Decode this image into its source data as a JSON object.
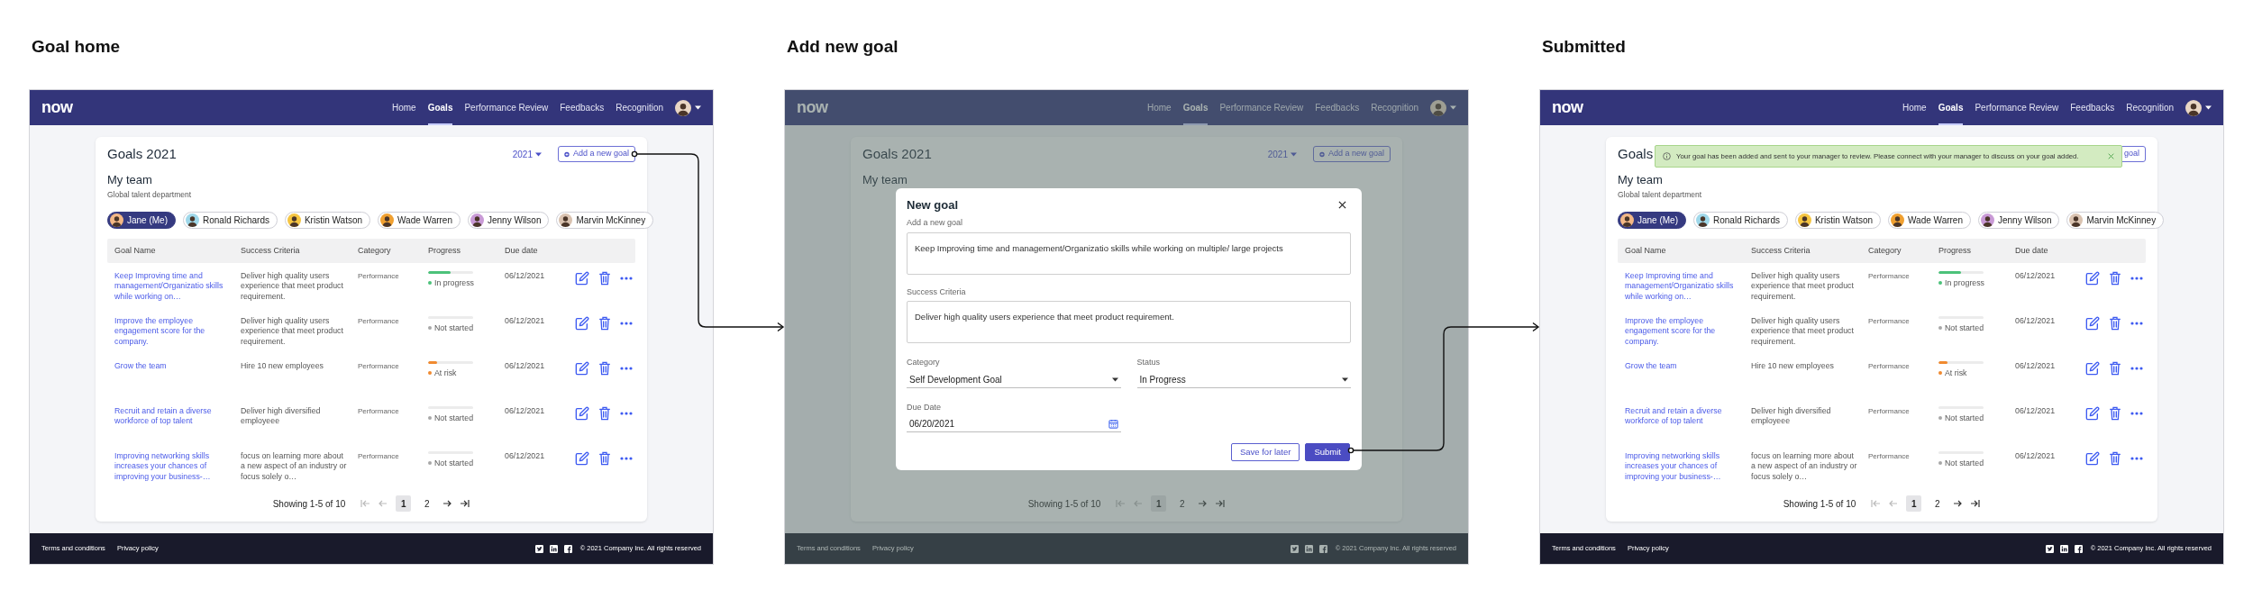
{
  "screens": [
    {
      "kind": "home",
      "title": "Goal home",
      "nav": {
        "logo": "now",
        "items": [
          {
            "label": "Home",
            "selected": false
          },
          {
            "label": "Goals",
            "selected": true
          },
          {
            "label": "Performance Review",
            "selected": false
          },
          {
            "label": "Feedbacks",
            "selected": false
          },
          {
            "label": "Recognition",
            "selected": false
          }
        ]
      },
      "card": {
        "heading": "Goals 2021",
        "year": "2021",
        "add_button": "Add a new goal",
        "team_title": "My team",
        "team_subtitle": "Global talent department",
        "members": [
          {
            "name": "Jane (Me)",
            "selected": true
          },
          {
            "name": "Ronald Richards",
            "selected": false
          },
          {
            "name": "Kristin Watson",
            "selected": false
          },
          {
            "name": "Wade Warren",
            "selected": false
          },
          {
            "name": "Jenny Wilson",
            "selected": false
          },
          {
            "name": "Marvin McKinney",
            "selected": false
          }
        ],
        "table": {
          "columns": [
            "Goal Name",
            "Success Criteria",
            "Category",
            "Progress",
            "Due date"
          ],
          "rows": [
            {
              "goal": "Keep Improving time and management/Organizatio skills while working on…",
              "criteria": "Deliver high quality users experience that meet product requirement.",
              "category": "Performance",
              "level": 0.5,
              "status": "In progress",
              "color": "#4cc27a",
              "due": "06/12/2021"
            },
            {
              "goal": "Improve the employee engagement score for the company.",
              "criteria": "Deliver high quality users experience that meet product requirement.",
              "category": "Performance",
              "level": 0,
              "status": "Not started",
              "color": "#a8a8a8",
              "due": "06/12/2021"
            },
            {
              "goal": "Grow the team",
              "criteria": "Hire 10 new employees",
              "category": "Performance",
              "level": 0.2,
              "status": "At risk",
              "color": "#f08a30",
              "due": "06/12/2021"
            },
            {
              "goal": "Recruit and retain a diverse workforce of top talent",
              "criteria": "Deliver high diversified employeee",
              "category": "Performance",
              "level": 0,
              "status": "Not started",
              "color": "#a8a8a8",
              "due": "06/12/2021"
            },
            {
              "goal": "Improving networking skills increases your chances of improving your business-…",
              "criteria": "focus on learning more about a new aspect of an industry or focus solely o…",
              "category": "Performance",
              "level": 0,
              "status": "Not started",
              "color": "#a8a8a8",
              "due": "06/12/2021"
            }
          ]
        },
        "pagination": {
          "summary": "Showing 1-5 of 10",
          "pages": [
            {
              "label": "1",
              "selected": true
            },
            {
              "label": "2",
              "selected": false
            }
          ]
        }
      },
      "footer": {
        "links": [
          "Terms and conditions",
          "Privacy policy"
        ],
        "copyright": "© 2021 Company Inc. All rights reserved"
      }
    },
    {
      "kind": "modal",
      "title": "Add new goal",
      "nav": {
        "logo": "now",
        "items": [
          {
            "label": "Home",
            "selected": false
          },
          {
            "label": "Goals",
            "selected": true
          },
          {
            "label": "Performance Review",
            "selected": false
          },
          {
            "label": "Feedbacks",
            "selected": false
          },
          {
            "label": "Recognition",
            "selected": false
          }
        ]
      },
      "card": {
        "heading": "Goals 2021",
        "year": "2021",
        "add_button": "Add a new goal",
        "team_title": "My team",
        "pagination": {
          "summary": "Showing 1-5 of 10",
          "pages": [
            {
              "label": "1",
              "selected": true
            },
            {
              "label": "2",
              "selected": false
            }
          ]
        }
      },
      "footer": {
        "links": [
          "Terms and conditions",
          "Privacy policy"
        ],
        "copyright": "© 2021 Company Inc. All rights reserved"
      },
      "modal": {
        "title": "New goal",
        "fields": [
          {
            "kind": "textarea",
            "label": "Add a new goal",
            "value": "Keep Improving time and management/Organizatio skills while working on multiple/ large projects"
          },
          {
            "kind": "textarea",
            "label": "Success Criteria",
            "value": "Deliver high quality users experience that meet product requirement."
          },
          {
            "kind": "select",
            "label": "Category",
            "value": "Self Development Goal"
          },
          {
            "kind": "select",
            "label": "Status",
            "value": "In Progress"
          },
          {
            "kind": "date",
            "label": "Due Date",
            "value": "06/20/2021"
          }
        ],
        "buttons": [
          {
            "kind": "secondary",
            "label": "Save for later"
          },
          {
            "kind": "primary",
            "label": "Submit"
          }
        ]
      }
    },
    {
      "kind": "toast",
      "title": "Submitted",
      "nav": {
        "logo": "now",
        "items": [
          {
            "label": "Home",
            "selected": false
          },
          {
            "label": "Goals",
            "selected": true
          },
          {
            "label": "Performance Review",
            "selected": false
          },
          {
            "label": "Feedbacks",
            "selected": false
          },
          {
            "label": "Recognition",
            "selected": false
          }
        ]
      },
      "card": {
        "heading": "Goals",
        "add_button": "goal",
        "team_title": "My team",
        "team_subtitle": "Global talent department",
        "members": [
          {
            "name": "Jane (Me)",
            "selected": true
          },
          {
            "name": "Ronald Richards",
            "selected": false
          },
          {
            "name": "Kristin Watson",
            "selected": false
          },
          {
            "name": "Wade Warren",
            "selected": false
          },
          {
            "name": "Jenny Wilson",
            "selected": false
          },
          {
            "name": "Marvin McKinney",
            "selected": false
          }
        ],
        "table": {
          "columns": [
            "Goal Name",
            "Success Criteria",
            "Category",
            "Progress",
            "Due date"
          ],
          "rows": [
            {
              "goal": "Keep Improving time and management/Organizatio skills while working on…",
              "criteria": "Deliver high quality users experience that meet product requirement.",
              "category": "Performance",
              "level": 0.5,
              "status": "In progress",
              "color": "#4cc27a",
              "due": "06/12/2021"
            },
            {
              "goal": "Improve the employee engagement score for the company.",
              "criteria": "Deliver high quality users experience that meet product requirement.",
              "category": "Performance",
              "level": 0,
              "status": "Not started",
              "color": "#a8a8a8",
              "due": "06/12/2021"
            },
            {
              "goal": "Grow the team",
              "criteria": "Hire 10 new employees",
              "category": "Performance",
              "level": 0.2,
              "status": "At risk",
              "color": "#f08a30",
              "due": "06/12/2021"
            },
            {
              "goal": "Recruit and retain a diverse workforce of top talent",
              "criteria": "Deliver high diversified employeee",
              "category": "Performance",
              "level": 0,
              "status": "Not started",
              "color": "#a8a8a8",
              "due": "06/12/2021"
            },
            {
              "goal": "Improving networking skills increases your chances of improving your business-…",
              "criteria": "focus on learning more about a new aspect of an industry or focus solely o…",
              "category": "Performance",
              "level": 0,
              "status": "Not started",
              "color": "#a8a8a8",
              "due": "06/12/2021"
            }
          ]
        },
        "pagination": {
          "summary": "Showing 1-5 of 10",
          "pages": [
            {
              "label": "1",
              "selected": true
            },
            {
              "label": "2",
              "selected": false
            }
          ]
        }
      },
      "footer": {
        "links": [
          "Terms and conditions",
          "Privacy policy"
        ],
        "copyright": "© 2021 Company Inc. All rights reserved"
      },
      "toast": {
        "message": "Your goal has been added and sent to your manager to review. Please connect with your manager to discuss on your goal added."
      }
    }
  ]
}
